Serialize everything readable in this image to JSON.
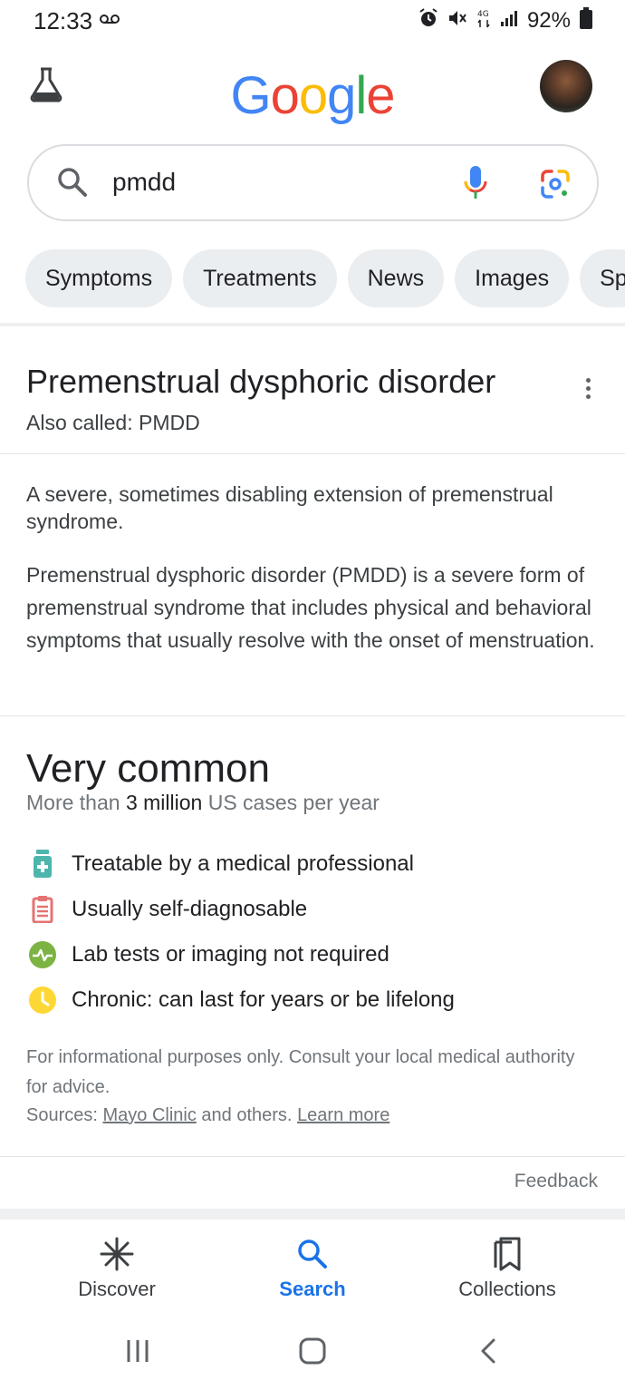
{
  "status_bar": {
    "time": "12:33",
    "battery": "92%"
  },
  "header": {
    "logo_letters": [
      "G",
      "o",
      "o",
      "g",
      "l",
      "e"
    ],
    "logo_colors": [
      "#4285F4",
      "#EA4335",
      "#FBBC05",
      "#4285F4",
      "#34A853",
      "#EA4335"
    ]
  },
  "search": {
    "query": "pmdd"
  },
  "chips": [
    "Symptoms",
    "Treatments",
    "News",
    "Images",
    "Sp"
  ],
  "panel": {
    "title": "Premenstrual dysphoric disorder",
    "also_called": "Also called: PMDD",
    "short_description": "A severe, sometimes disabling extension of premenstrual syndrome.",
    "long_description": "Premenstrual dysphoric disorder (PMDD) is a severe form of premenstrual syndrome that includes physical and behavioral symptoms that usually resolve with the onset of menstruation.",
    "frequency_heading": "Very common",
    "frequency_prefix": "More than",
    "frequency_count": "3 million",
    "frequency_suffix": "US cases per year",
    "facts": [
      {
        "icon": "medicine-bottle-icon",
        "text": "Treatable by a medical professional"
      },
      {
        "icon": "clipboard-icon",
        "text": "Usually self-diagnosable"
      },
      {
        "icon": "pulse-icon",
        "text": "Lab tests or imaging not required"
      },
      {
        "icon": "clock-icon",
        "text": "Chronic: can last for years or be lifelong"
      }
    ],
    "disclaimer": "For informational purposes only. Consult your local medical authority for advice.",
    "sources_prefix": "Sources:",
    "source_link": "Mayo Clinic",
    "sources_middle": "and others.",
    "learn_more": "Learn more",
    "feedback": "Feedback"
  },
  "bottom_nav": {
    "discover": "Discover",
    "search": "Search",
    "collections": "Collections"
  },
  "colors": {
    "accent_blue": "#1a73e8",
    "chip_bg": "#ebeef0",
    "teal": "#4db6ac",
    "red": "#e57373",
    "green": "#7cb342",
    "yellow": "#fdd835"
  }
}
